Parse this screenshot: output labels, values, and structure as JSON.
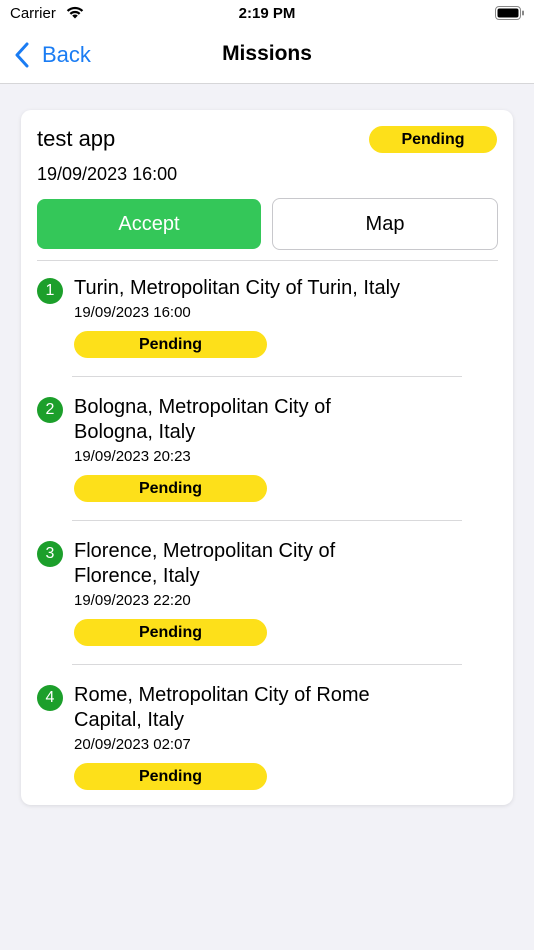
{
  "status_bar": {
    "carrier": "Carrier",
    "time": "2:19 PM"
  },
  "nav": {
    "back_label": "Back",
    "title": "Missions"
  },
  "mission": {
    "title": "test app",
    "date": "19/09/2023 16:00",
    "status": "Pending",
    "accept_label": "Accept",
    "map_label": "Map",
    "stops": [
      {
        "number": "1",
        "address": "Turin, Metropolitan City of Turin, Italy",
        "date": "19/09/2023 16:00",
        "status": "Pending"
      },
      {
        "number": "2",
        "address": "Bologna, Metropolitan City of Bologna, Italy",
        "date": "19/09/2023 20:23",
        "status": "Pending"
      },
      {
        "number": "3",
        "address": "Florence, Metropolitan City of Florence, Italy",
        "date": "19/09/2023 22:20",
        "status": "Pending"
      },
      {
        "number": "4",
        "address": "Rome, Metropolitan City of Rome Capital, Italy",
        "date": "20/09/2023 02:07",
        "status": "Pending"
      }
    ]
  },
  "colors": {
    "accent": "#1a7cf3",
    "accept": "#34c759",
    "pending": "#fde01a",
    "stop_number": "#1c9f2b"
  }
}
